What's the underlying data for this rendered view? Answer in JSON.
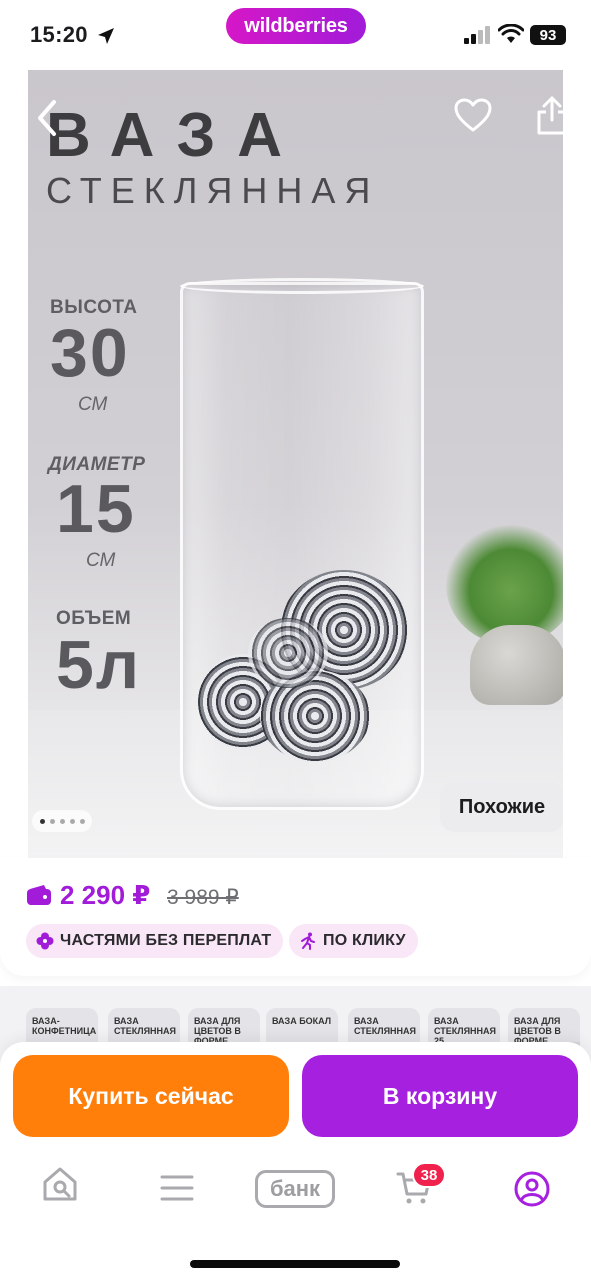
{
  "status_bar": {
    "time": "15:20",
    "brand": "wildberries",
    "battery": "93",
    "icons": [
      "location-arrow-icon",
      "signal-icon",
      "wifi-icon",
      "battery-icon"
    ]
  },
  "hero": {
    "title": "ВАЗА",
    "subtitle": "СТЕКЛЯННАЯ",
    "specs": [
      {
        "label": "ВЫСОТА",
        "value": "30",
        "unit": "СМ"
      },
      {
        "label": "ДИАМЕТР",
        "value": "15",
        "unit": "СМ"
      },
      {
        "label": "ОБЪЕМ",
        "value": "5л",
        "unit": ""
      }
    ],
    "similar_button": "Похожие",
    "image_pages": 5,
    "active_page": 1,
    "icons": [
      "back-icon",
      "heart-icon",
      "share-icon"
    ]
  },
  "price": {
    "current": "2 290 ₽",
    "old": "3 989 ₽",
    "accent_color": "#a11bd9",
    "chips": [
      {
        "label": "ЧАСТЯМИ БЕЗ ПЕРЕПЛАТ",
        "icon": "clover-icon"
      },
      {
        "label": "ПО КЛИКУ",
        "icon": "running-person-icon"
      }
    ]
  },
  "gallery": {
    "thumbnails": [
      {
        "text": "ВАЗА-КОНФЕТНИЦА"
      },
      {
        "text": "ВАЗА СТЕКЛЯННАЯ"
      },
      {
        "text": "ВАЗА ДЛЯ ЦВЕТОВ В ФОРМЕ КОЛБЫ"
      },
      {
        "text": "ВАЗА БОКАЛ"
      },
      {
        "text": "ВАЗА СТЕКЛЯННАЯ"
      },
      {
        "text": "ВАЗА СТЕКЛЯННАЯ 25"
      },
      {
        "text": "ВАЗА ДЛЯ ЦВЕТОВ В ФОРМЕ БОКАЛА"
      }
    ]
  },
  "actions": {
    "buy_now": "Купить сейчас",
    "add_to_cart": "В корзину",
    "buy_color": "#ff7f0a",
    "cart_color": "#a620e0"
  },
  "tabbar": {
    "items": [
      {
        "name": "home",
        "icon": "home-search-icon"
      },
      {
        "name": "catalog",
        "icon": "menu-icon"
      },
      {
        "name": "bank",
        "label": "банк"
      },
      {
        "name": "cart",
        "icon": "cart-icon",
        "badge": "38"
      },
      {
        "name": "profile",
        "icon": "profile-icon"
      }
    ]
  }
}
